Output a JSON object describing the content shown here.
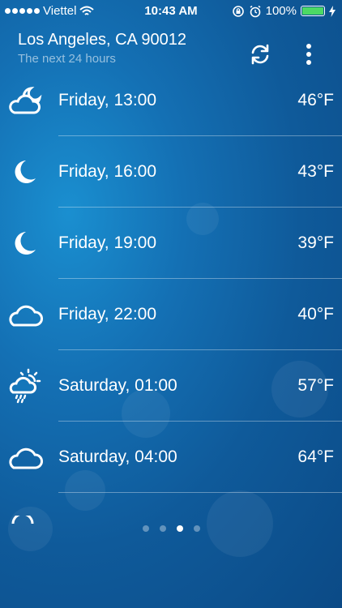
{
  "status": {
    "carrier": "Viettel",
    "time": "10:43 AM",
    "battery_text": "100%",
    "battery_level": 1.0,
    "battery_color": "#4cd964"
  },
  "header": {
    "location": "Los Angeles, CA 90012",
    "subtitle": "The next 24 hours",
    "refresh_icon": "refresh-icon",
    "menu_icon": "more-vertical-icon"
  },
  "forecast": [
    {
      "label": "Friday, 13:00",
      "temp": "46°F",
      "icon": "partly-cloudy-night-icon"
    },
    {
      "label": "Friday, 16:00",
      "temp": "43°F",
      "icon": "moon-icon"
    },
    {
      "label": "Friday, 19:00",
      "temp": "39°F",
      "icon": "moon-icon"
    },
    {
      "label": "Friday, 22:00",
      "temp": "40°F",
      "icon": "cloud-icon"
    },
    {
      "label": "Saturday, 01:00",
      "temp": "57°F",
      "icon": "sun-cloud-rain-icon"
    },
    {
      "label": "Saturday, 04:00",
      "temp": "64°F",
      "icon": "cloud-icon"
    }
  ],
  "pager": {
    "count": 4,
    "active_index": 2
  }
}
